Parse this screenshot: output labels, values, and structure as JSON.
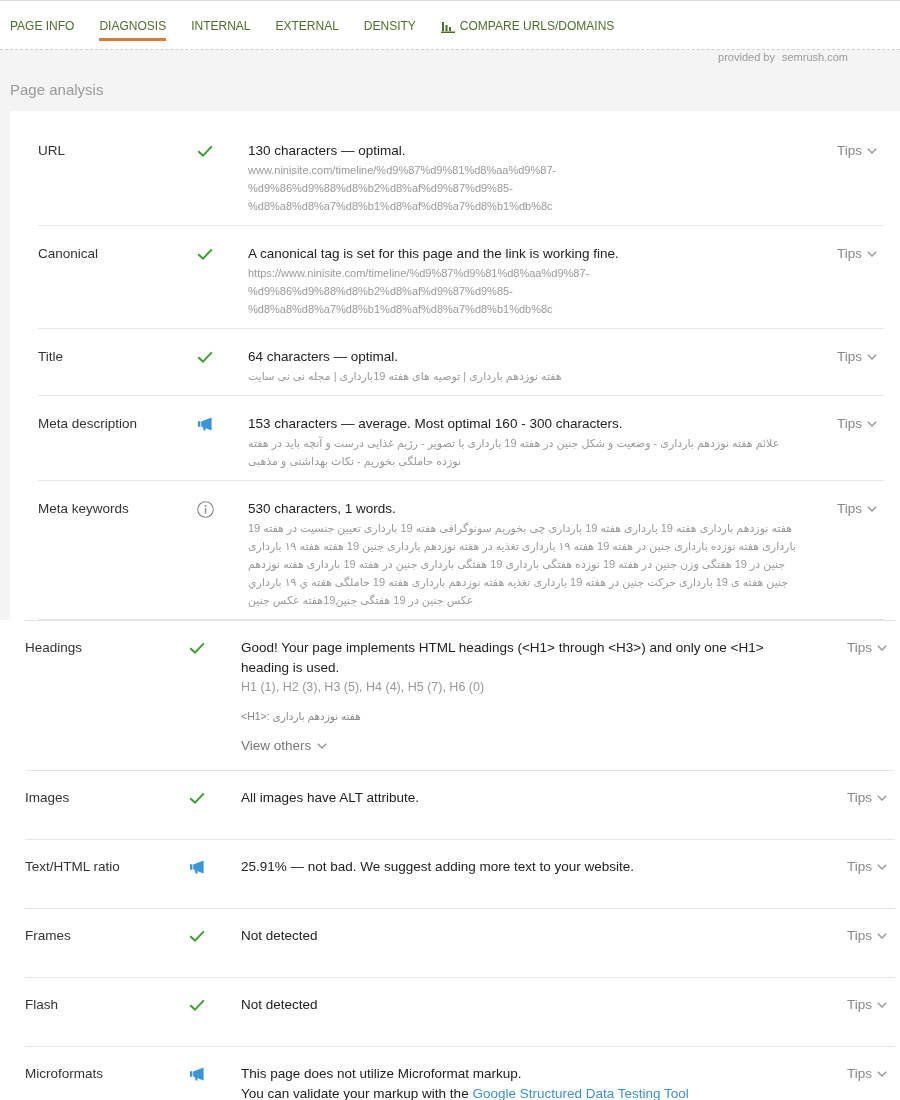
{
  "tabs": [
    {
      "label": "PAGE INFO",
      "selected": false,
      "kind": "text"
    },
    {
      "label": "DIAGNOSIS",
      "selected": true,
      "kind": "text"
    },
    {
      "label": "INTERNAL",
      "selected": false,
      "kind": "text"
    },
    {
      "label": "EXTERNAL",
      "selected": false,
      "kind": "text"
    },
    {
      "label": "DENSITY",
      "selected": false,
      "kind": "text"
    },
    {
      "label": "COMPARE URLS/DOMAINS",
      "selected": false,
      "kind": "chart"
    }
  ],
  "provider": {
    "prefix": "provided by",
    "brand": "semrush.com"
  },
  "section_title": "Page analysis",
  "page_analysis": {
    "rows": [
      {
        "label": "URL",
        "kind": "passed",
        "summary": "130 characters — optimal.",
        "details": [
          "www.ninisite.com/timeline/%d9%87%d9%81%d8%aa%d9%87-%d9%86%d9%88%d8%b2%d8%af%d9%87%d9%85-%d8%a8%d8%a7%d8%b1%d8%af%d8%a7%d8%b1%db%8c"
        ],
        "tips": "Tips"
      },
      {
        "label": "Canonical",
        "kind": "passed",
        "summary": "A canonical tag is set for this page and the link is working fine.",
        "details": [
          "https://www.ninisite.com/timeline/%d9%87%d9%81%d8%aa%d9%87-%d9%86%d9%88%d8%b2%d8%af%d9%87%d9%85-%d8%a8%d8%a7%d8%b1%d8%af%d8%a7%d8%b1%db%8c"
        ],
        "tips": "Tips"
      },
      {
        "label": "Title",
        "kind": "passed",
        "summary": "64 characters — optimal.",
        "details": [
          "هفته نوزدهم بارداری | توصیه های هفته 19بارداری | مجله نی نی سایت"
        ],
        "tips": "Tips"
      },
      {
        "label": "Meta description",
        "kind": "notice",
        "summary": "153 characters — average. Most optimal 160 - 300 characters.",
        "details": [
          "علائم هفته نوزدهم بارداری - وضعیت و شکل جنین در هفته 19 بارداری با تصویر - رژیم غذایی درست و آنچه باید در هفته نوزده حاملگی بخوریم - نکات بهداشتی و مذهبی"
        ],
        "tips": "Tips"
      },
      {
        "label": "Meta keywords",
        "kind": "info",
        "summary": "530 characters, 1 words.",
        "details": [
          "هفته نوزدهم بارداری هفته 19 بارداری هفته 19 بارداری چی بخوریم سونوگرافی هفته 19 بارداری تعیین جنسیت در هفته 19 بارداری هفته نوزده بارداری جنین در هفته 19 هفته ۱۹ بارداری تغذیه در هفته نوزدهم بارداری جنین 19 هفته هفته ۱۹ بارداری جنین در 19 هفتگی وزن جنین در هفته 19 نوزده هفتگی بارداری 19 هفتگی بارداری جنین در هفته 19 بارداری هفته نوزدهم جنین هفته ی 19 بارداری حرکت جنین در هفته 19 بارداری تغذیه هفته نوزدهم بارداری هفته 19 حاملگی هفته ي ۱۹ بارداري عكس جنين در 19 هفتگی جنین19هفته عکس جنین"
        ],
        "tips": "Tips"
      }
    ]
  },
  "more_checks": {
    "rows": [
      {
        "label": "Headings",
        "kind": "passed",
        "summary": "Good! Your page implements HTML headings (<H1> through <H3>) and only one <H1> heading is used.",
        "counts": "H1 (1), H2 (3), H3 (5), H4 (4), H5 (7), H6 (0)",
        "h1": "<H1>: هفته نوزدهم بارداری",
        "view_others": "View others",
        "tips": "Tips"
      },
      {
        "label": "Images",
        "kind": "passed",
        "summary": "All images have ALT attribute.",
        "tips": "Tips"
      },
      {
        "label": "Text/HTML ratio",
        "kind": "notice",
        "summary": "25.91% — not bad. We suggest adding more text to your website.",
        "tips": "Tips"
      },
      {
        "label": "Frames",
        "kind": "passed",
        "summary": "Not detected",
        "tips": "Tips"
      },
      {
        "label": "Flash",
        "kind": "passed",
        "summary": "Not detected",
        "tips": "Tips"
      },
      {
        "label": "Microformats",
        "kind": "notice",
        "summary": "This page does not utilize Microformat markup.",
        "note": {
          "text": "You can validate your markup with the",
          "link": "Google Structured Data Testing Tool"
        },
        "tips": "Tips"
      }
    ]
  }
}
